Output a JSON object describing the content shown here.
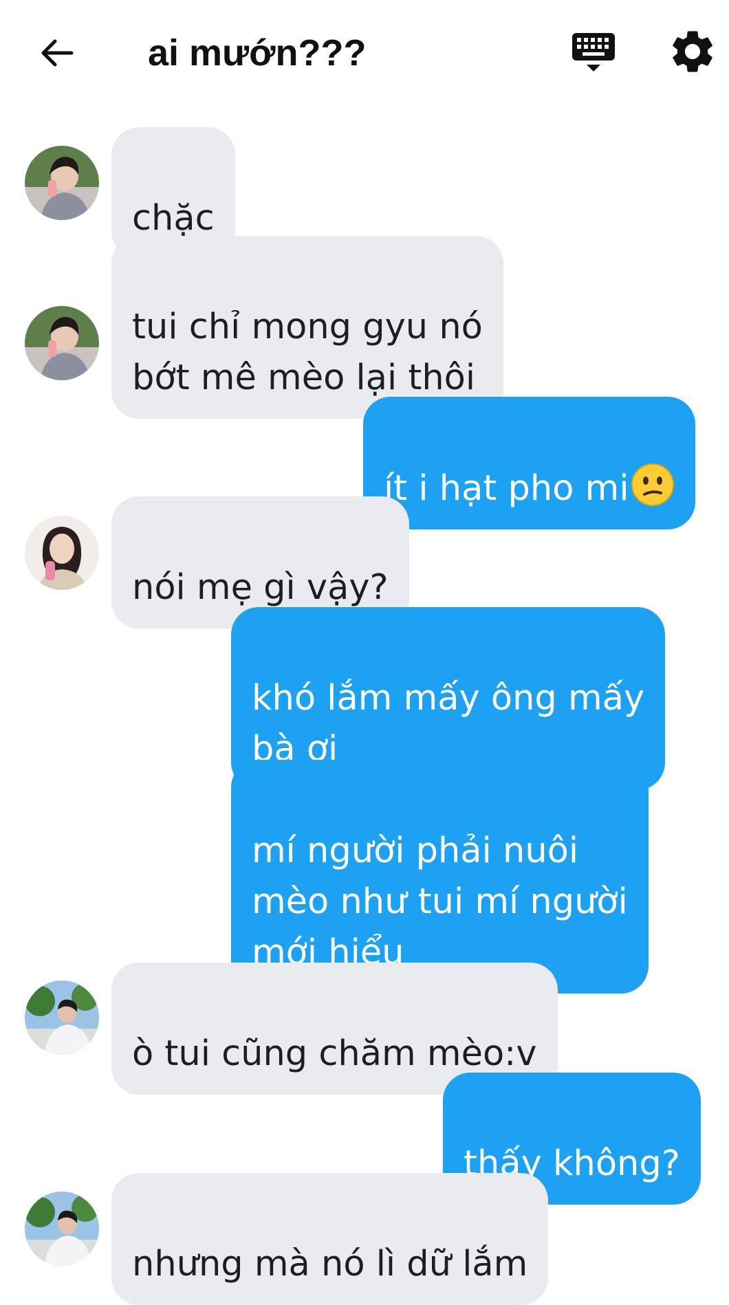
{
  "header": {
    "title": "ai mướn???",
    "back_icon": "arrow-left-icon",
    "keyboard_icon": "keyboard-icon",
    "settings_icon": "gear-icon"
  },
  "colors": {
    "outgoing_bubble": "#1da1f2",
    "incoming_bubble": "#e9ebef",
    "text_dark": "#1c1e21",
    "text_light": "#ffffff"
  },
  "messages": [
    {
      "direction": "in",
      "sender": "user-a",
      "text": "chặc"
    },
    {
      "direction": "in",
      "sender": "user-a",
      "text": "tui chỉ mong gyu nó\nbớt mê mèo lại thôi"
    },
    {
      "direction": "out",
      "text": "ít i hạt pho mi",
      "emoji": "confused-face"
    },
    {
      "direction": "in",
      "sender": "user-b",
      "text": "nói mẹ gì vậy?"
    },
    {
      "direction": "out",
      "text": "khó lắm mấy ông mấy\nbà ơi"
    },
    {
      "direction": "out",
      "text": "mí người phải nuôi\nmèo như tui mí người\nmới hiểu"
    },
    {
      "direction": "in",
      "sender": "user-c",
      "text": "ò tui cũng chăm mèo:v"
    },
    {
      "direction": "out",
      "text": "thấy không?"
    },
    {
      "direction": "in",
      "sender": "user-c",
      "text": "nhưng mà nó lì dữ lắm"
    }
  ]
}
